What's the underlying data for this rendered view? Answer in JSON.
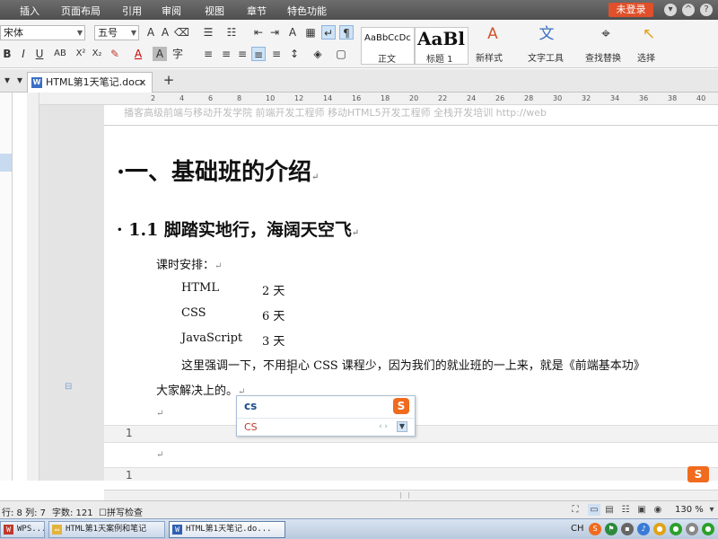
{
  "menu": [
    "插入",
    "页面布局",
    "引用",
    "审阅",
    "视图",
    "章节",
    "特色功能"
  ],
  "login_label": "未登录",
  "ribbon": {
    "font_name": "宋体",
    "font_size": "五号",
    "styles": [
      {
        "sample": "AaBbCcDc",
        "name": "正文"
      },
      {
        "sample": "AaBl",
        "name": "标题 1"
      }
    ],
    "new_style": "新样式",
    "text_tools": "文字工具",
    "find_replace": "查找替换",
    "select": "选择"
  },
  "tab": {
    "title": "HTML第1天笔记.docx"
  },
  "ruler_marks": [
    "2",
    "4",
    "6",
    "8",
    "10",
    "12",
    "14",
    "16",
    "18",
    "20",
    "22",
    "24",
    "26",
    "28",
    "30",
    "32",
    "34",
    "36",
    "38",
    "40"
  ],
  "document": {
    "header_text": "播客高级前端与移动开发学院   前端开发工程师 移动HTML5开发工程师 全栈开发培训   http://web",
    "h1": "·一、基础班的介绍",
    "h2": "· 1.1  脚踏实地行，海阔天空飞",
    "schedule_label": "课时安排：",
    "schedule": [
      {
        "course": "HTML",
        "days": "2 天"
      },
      {
        "course": "CSS",
        "days": "6 天"
      },
      {
        "course": "JavaScript",
        "days": "3 天"
      }
    ],
    "note_line1": "这里强调一下，不用担心 CSS 课程少，因为我们的就业班的一上来，就是《前端基本功》",
    "note_line2": "大家解决上的。",
    "line_numbers": [
      "1",
      "1"
    ],
    "para_mark": "↵"
  },
  "ime": {
    "composition": "cs",
    "candidate": "CS",
    "logo": "S"
  },
  "status": {
    "row_col": "行: 8  列: 7",
    "word_count": "字数: 121",
    "spell_check": "拼写检查",
    "zoom": "130 %"
  },
  "taskbar": {
    "items": [
      "WPS...",
      "HTML第1天案例和笔记",
      "HTML第1天笔记.do..."
    ],
    "lang": "CH"
  }
}
